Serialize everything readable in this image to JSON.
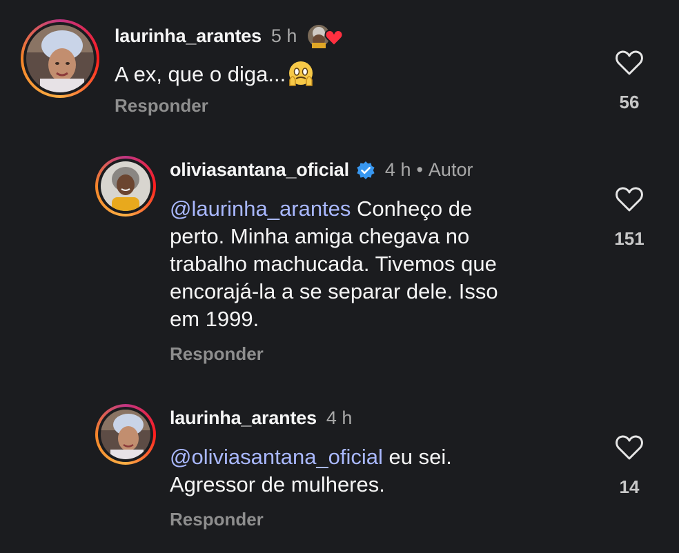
{
  "comments": [
    {
      "username": "laurinha_arantes",
      "time": "5 h",
      "text_before": "A ex, que o diga...",
      "emoji": "face-holding-back-tears",
      "reply_label": "Responder",
      "likes": "56",
      "liked_by_author": true
    },
    {
      "username": "oliviasantana_oficial",
      "verified": true,
      "time": "4 h",
      "separator": "•",
      "author_label": "Autor",
      "mention": "@laurinha_arantes",
      "text_lines": [
        " Conheço de",
        "perto. Minha amiga chegava no",
        "trabalho machucada. Tivemos que",
        "encorajá-la a se separar dele. Isso",
        "em 1999."
      ],
      "reply_label": "Responder",
      "likes": "151"
    },
    {
      "username": "laurinha_arantes",
      "time": "4 h",
      "mention": "@oliviasantana_oficial",
      "text_lines": [
        " eu sei.",
        "Agressor de mulheres."
      ],
      "reply_label": "Responder",
      "likes": "14"
    }
  ],
  "colors": {
    "background": "#1b1c1f",
    "mention": "#a9b8ff",
    "verified": "#3897f0",
    "heart": "#ff3040"
  },
  "icons": [
    "heart-outline-icon",
    "verified-badge-icon",
    "liked-by-author-heart-icon"
  ]
}
